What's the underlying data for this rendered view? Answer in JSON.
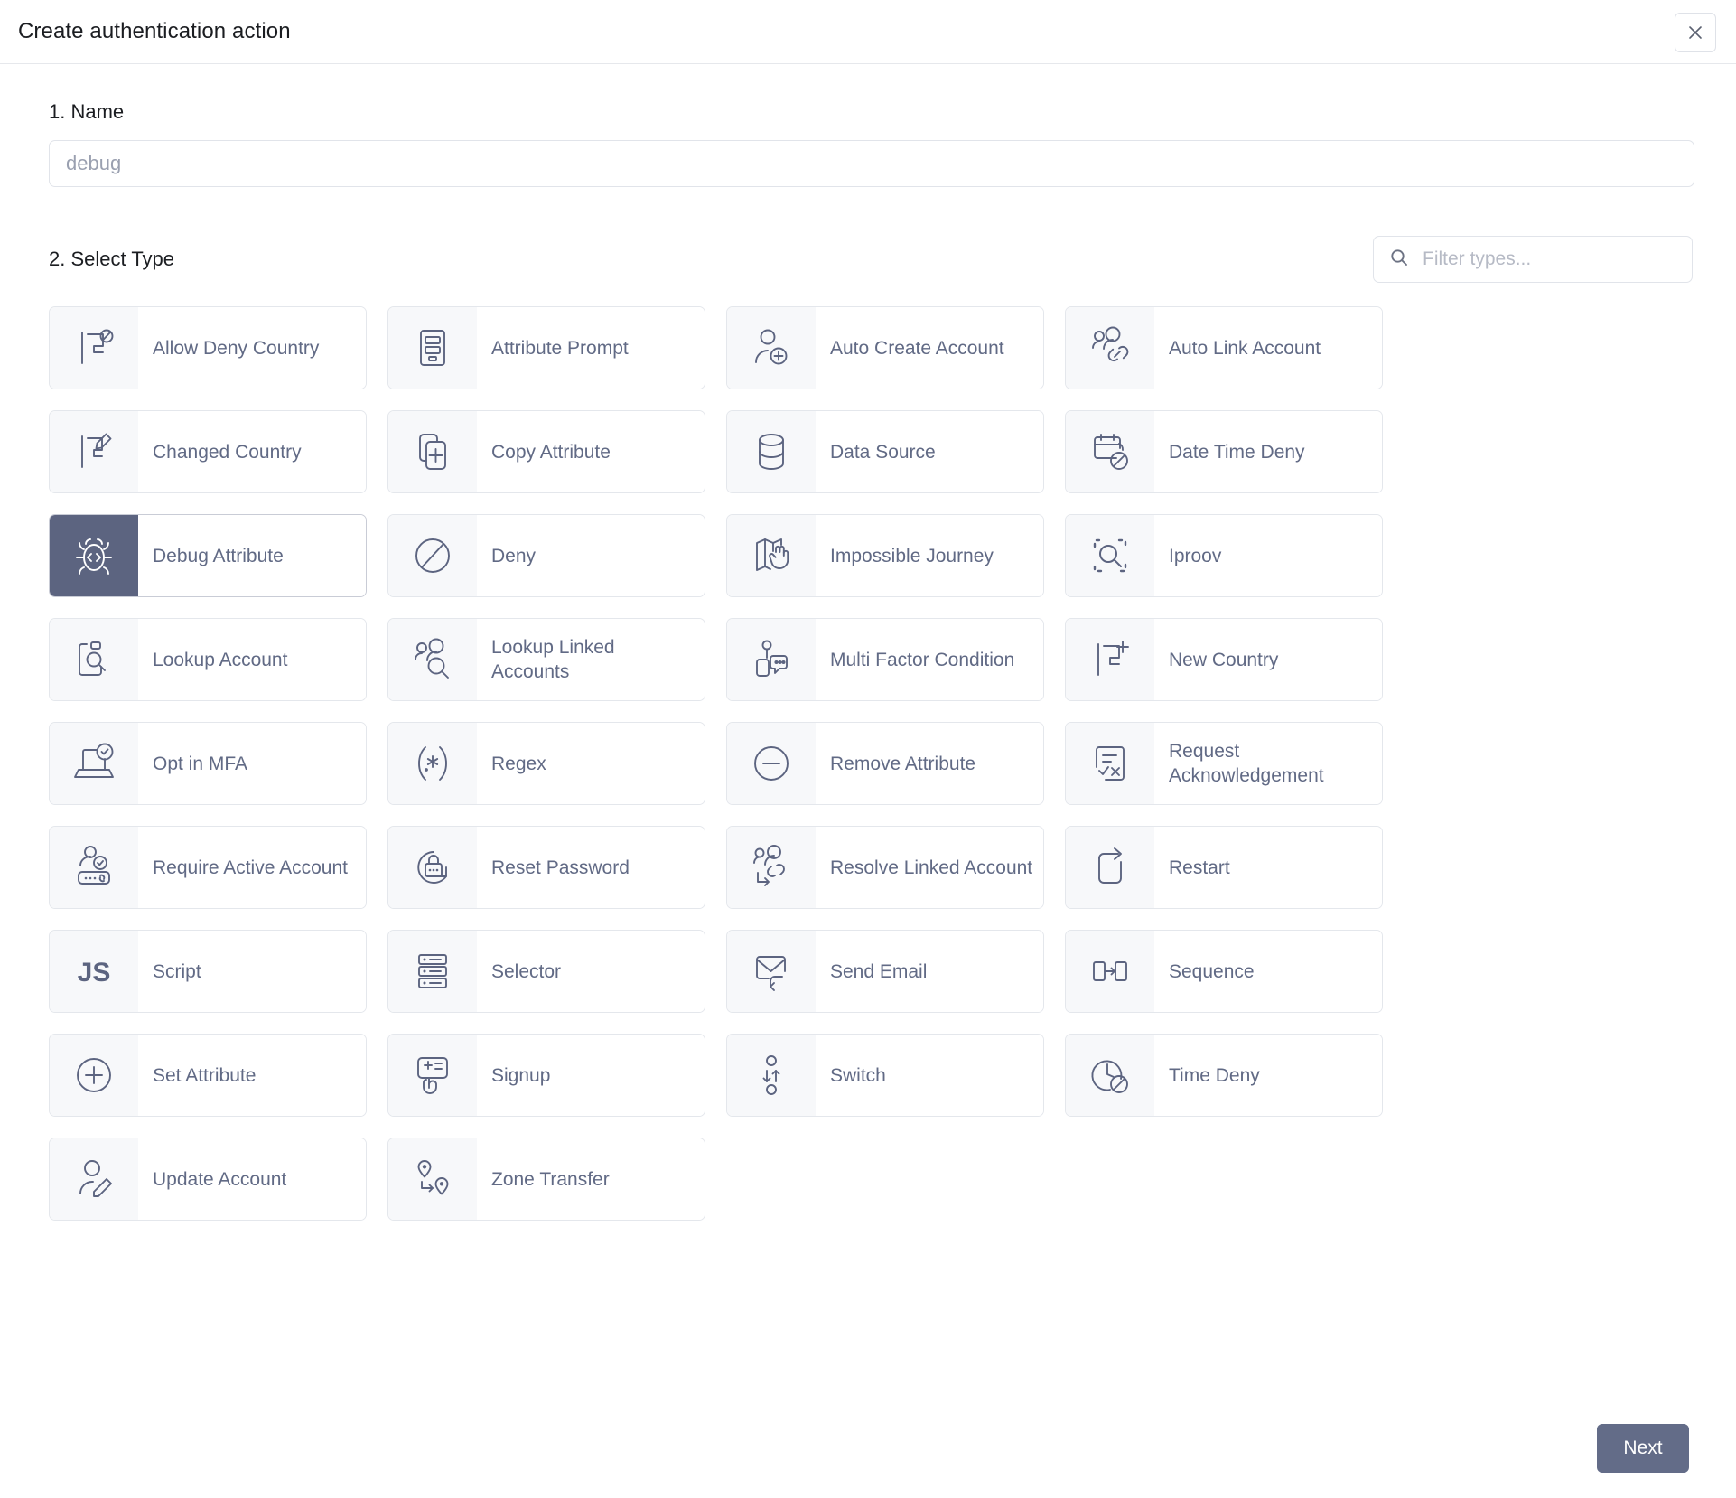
{
  "header": {
    "title": "Create authentication action",
    "close_icon": "close-icon"
  },
  "name_section": {
    "label": "1. Name",
    "value": "",
    "placeholder": "debug"
  },
  "select_type_section": {
    "label": "2. Select Type",
    "filter": {
      "value": "",
      "placeholder": "Filter types...",
      "icon": "search-icon"
    },
    "types": [
      {
        "label": "Allow Deny Country",
        "icon": "flag-deny-icon",
        "selected": false
      },
      {
        "label": "Attribute Prompt",
        "icon": "form-list-icon",
        "selected": false
      },
      {
        "label": "Auto Create Account",
        "icon": "user-plus-icon",
        "selected": false
      },
      {
        "label": "Auto Link Account",
        "icon": "users-link-icon",
        "selected": false
      },
      {
        "label": "Changed Country",
        "icon": "flag-edit-icon",
        "selected": false
      },
      {
        "label": "Copy Attribute",
        "icon": "copy-plus-icon",
        "selected": false
      },
      {
        "label": "Data Source",
        "icon": "database-icon",
        "selected": false
      },
      {
        "label": "Date Time Deny",
        "icon": "calendar-deny-icon",
        "selected": false
      },
      {
        "label": "Debug Attribute",
        "icon": "bug-code-icon",
        "selected": true
      },
      {
        "label": "Deny",
        "icon": "deny-circle-icon",
        "selected": false
      },
      {
        "label": "Impossible Journey",
        "icon": "map-hand-icon",
        "selected": false
      },
      {
        "label": "Iproov",
        "icon": "scan-search-icon",
        "selected": false
      },
      {
        "label": "Lookup Account",
        "icon": "card-search-icon",
        "selected": false
      },
      {
        "label": "Lookup Linked Accounts",
        "icon": "users-search-icon",
        "selected": false
      },
      {
        "label": "Multi Factor Condition",
        "icon": "device-chat-icon",
        "selected": false
      },
      {
        "label": "New Country",
        "icon": "flag-plus-icon",
        "selected": false
      },
      {
        "label": "Opt in MFA",
        "icon": "laptop-check-icon",
        "selected": false
      },
      {
        "label": "Regex",
        "icon": "regex-icon",
        "selected": false
      },
      {
        "label": "Remove Attribute",
        "icon": "minus-circle-icon",
        "selected": false
      },
      {
        "label": "Request Acknowledgement",
        "icon": "doc-checkx-icon",
        "selected": false
      },
      {
        "label": "Require Active Account",
        "icon": "user-device-check-icon",
        "selected": false
      },
      {
        "label": "Reset Password",
        "icon": "lock-reset-icon",
        "selected": false
      },
      {
        "label": "Resolve Linked Account",
        "icon": "users-resolve-icon",
        "selected": false
      },
      {
        "label": "Restart",
        "icon": "restart-icon",
        "selected": false
      },
      {
        "label": "Script",
        "icon": "js-icon",
        "selected": false
      },
      {
        "label": "Selector",
        "icon": "selector-rows-icon",
        "selected": false
      },
      {
        "label": "Send Email",
        "icon": "send-email-icon",
        "selected": false
      },
      {
        "label": "Sequence",
        "icon": "sequence-icon",
        "selected": false
      },
      {
        "label": "Set Attribute",
        "icon": "plus-circle-icon",
        "selected": false
      },
      {
        "label": "Signup",
        "icon": "signup-tap-icon",
        "selected": false
      },
      {
        "label": "Switch",
        "icon": "switch-arrows-icon",
        "selected": false
      },
      {
        "label": "Time Deny",
        "icon": "clock-deny-icon",
        "selected": false
      },
      {
        "label": "Update Account",
        "icon": "user-edit-icon",
        "selected": false
      },
      {
        "label": "Zone Transfer",
        "icon": "zone-transfer-icon",
        "selected": false
      }
    ]
  },
  "footer": {
    "next_label": "Next"
  },
  "colors": {
    "accent": "#5c6480",
    "button": "#636c88",
    "icon_tile": "#f7f8fa",
    "border": "#e4e7ec",
    "label_text": "#616a85",
    "title_text": "#1b1d21"
  }
}
